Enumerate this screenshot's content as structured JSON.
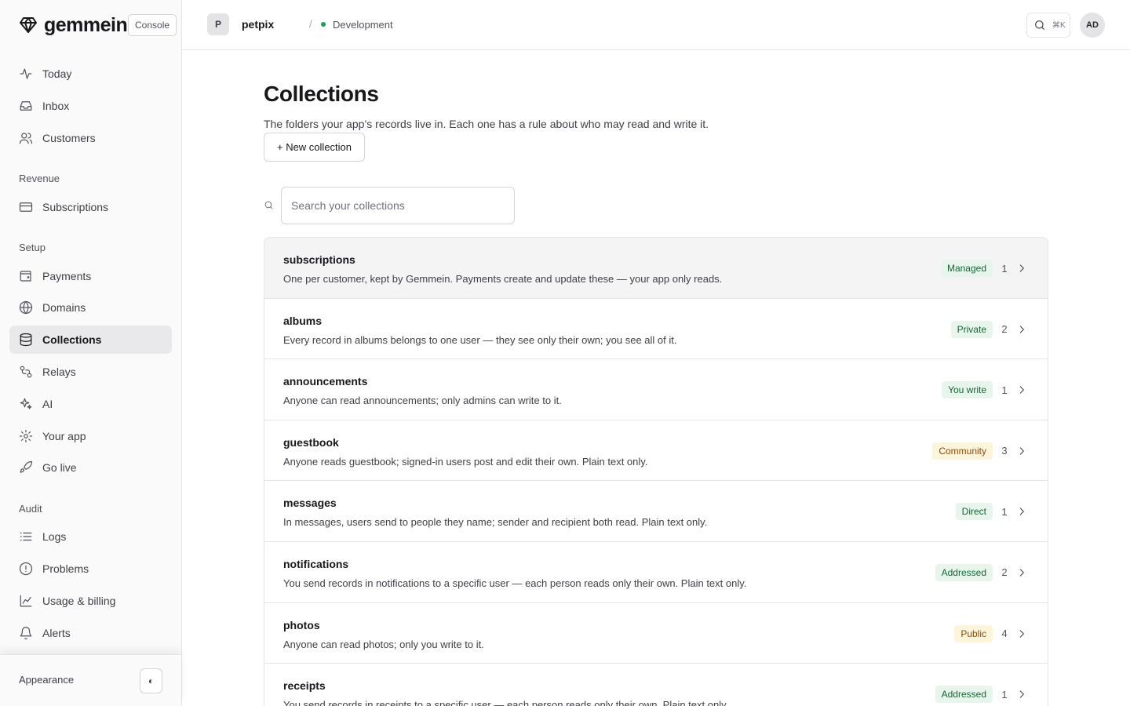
{
  "brand": {
    "name": "gemmein",
    "console_label": "Console"
  },
  "nav": {
    "top": [
      {
        "label": "Today",
        "icon": "activity-icon"
      },
      {
        "label": "Inbox",
        "icon": "inbox-icon"
      },
      {
        "label": "Customers",
        "icon": "users-icon"
      }
    ],
    "revenue_label": "Revenue",
    "revenue": [
      {
        "label": "Subscriptions",
        "icon": "credit-card-icon"
      }
    ],
    "setup_label": "Setup",
    "setup": [
      {
        "label": "Payments",
        "icon": "wallet-icon"
      },
      {
        "label": "Domains",
        "icon": "globe-icon"
      },
      {
        "label": "Collections",
        "icon": "database-icon",
        "active": true
      },
      {
        "label": "Relays",
        "icon": "relay-icon"
      },
      {
        "label": "AI",
        "icon": "sparkles-icon"
      },
      {
        "label": "Your app",
        "icon": "gear-icon"
      },
      {
        "label": "Go live",
        "icon": "rocket-icon"
      }
    ],
    "audit_label": "Audit",
    "audit": [
      {
        "label": "Logs",
        "icon": "list-icon"
      },
      {
        "label": "Problems",
        "icon": "alert-circle-icon"
      },
      {
        "label": "Usage & billing",
        "icon": "chart-icon"
      },
      {
        "label": "Alerts",
        "icon": "bell-icon"
      }
    ]
  },
  "footer": {
    "appearance_label": "Appearance",
    "theme_icon": "◐"
  },
  "topbar": {
    "project_initial": "P",
    "project_name": "petpix",
    "separator": "/",
    "environment": "Development",
    "search_shortcut": "⌘K",
    "user_initials": "AD"
  },
  "page": {
    "title": "Collections",
    "description": "The folders your app’s records live in. Each one has a rule about who may read and write it.",
    "new_button": "+ New collection",
    "search_placeholder": "Search your collections"
  },
  "colors": {
    "accent_green": "#166534",
    "badge_green_bg": "#e8f5ec",
    "badge_amber_bg": "#fdf4dc",
    "status_dot": "#16a34a"
  },
  "collections": [
    {
      "name": "subscriptions",
      "description": "One per customer, kept by Gemmein. Payments create and update these — your app only reads.",
      "badge": "Managed",
      "tone": "green",
      "count": "1"
    },
    {
      "name": "albums",
      "description": "Every record in albums belongs to one user — they see only their own; you see all of it.",
      "badge": "Private",
      "tone": "green",
      "count": "2"
    },
    {
      "name": "announcements",
      "description": "Anyone can read announcements; only admins can write to it.",
      "badge": "You write",
      "tone": "green",
      "count": "1"
    },
    {
      "name": "guestbook",
      "description": "Anyone reads guestbook; signed-in users post and edit their own. Plain text only.",
      "badge": "Community",
      "tone": "amber",
      "count": "3"
    },
    {
      "name": "messages",
      "description": "In messages, users send to people they name; sender and recipient both read. Plain text only.",
      "badge": "Direct",
      "tone": "green",
      "count": "1"
    },
    {
      "name": "notifications",
      "description": "You send records in notifications to a specific user — each person reads only their own. Plain text only.",
      "badge": "Addressed",
      "tone": "green",
      "count": "2"
    },
    {
      "name": "photos",
      "description": "Anyone can read photos; only you write to it.",
      "badge": "Public",
      "tone": "amber",
      "count": "4"
    },
    {
      "name": "receipts",
      "description": "You send records in receipts to a specific user — each person reads only their own. Plain text only.",
      "badge": "Addressed",
      "tone": "green",
      "count": "1"
    }
  ]
}
